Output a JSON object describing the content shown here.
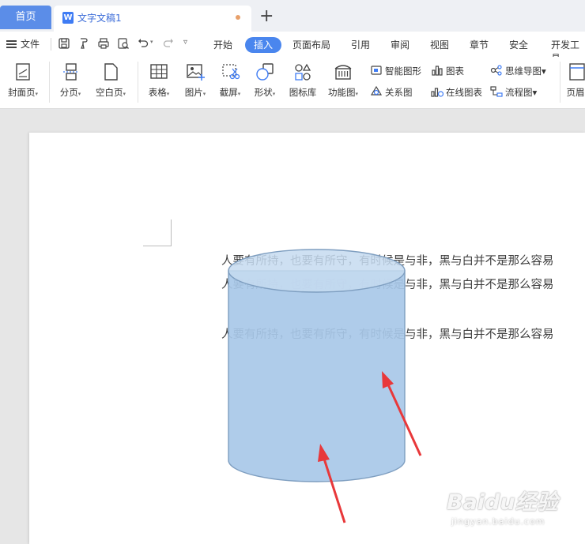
{
  "tabs": {
    "home": "首页",
    "doc_icon_letter": "W",
    "doc_title": "文字文稿1",
    "new_tab": "+"
  },
  "menubar": {
    "file": "文件",
    "items": [
      "开始",
      "插入",
      "页面布局",
      "引用",
      "审阅",
      "视图",
      "章节",
      "安全",
      "开发工具"
    ],
    "active": "插入"
  },
  "ribbon": {
    "cover": "封面页",
    "page_break": "分页",
    "blank_page": "空白页",
    "table": "表格",
    "picture": "图片",
    "screenshot": "截屏",
    "shape": "形状",
    "icon_lib": "图标库",
    "function_chart": "功能图",
    "smart_graphic": "智能图形",
    "chart": "图表",
    "relation": "关系图",
    "online_chart": "在线图表",
    "mindmap": "思维导图",
    "flowchart": "流程图",
    "header": "页眉"
  },
  "document": {
    "lines": [
      "人要有所持，也要有所守，有时候是与非，黑与白并不是那么容易",
      "人要有所持，也要有所守，有时候是与非，黑与白并不是那么容易",
      "人要有所持，也要有所守，有时候是与非，黑与白并不是那么容易"
    ]
  },
  "watermark": {
    "brand": "Baidu经验",
    "url": "jingyan.baidu.com"
  },
  "colors": {
    "accent": "#4a86ee",
    "home_tab": "#5b8de8",
    "cylinder_fill": "#a8c8e8",
    "cylinder_top": "#c6dbf0",
    "cylinder_stroke": "#7e9ec0",
    "arrow": "#e8383a"
  }
}
